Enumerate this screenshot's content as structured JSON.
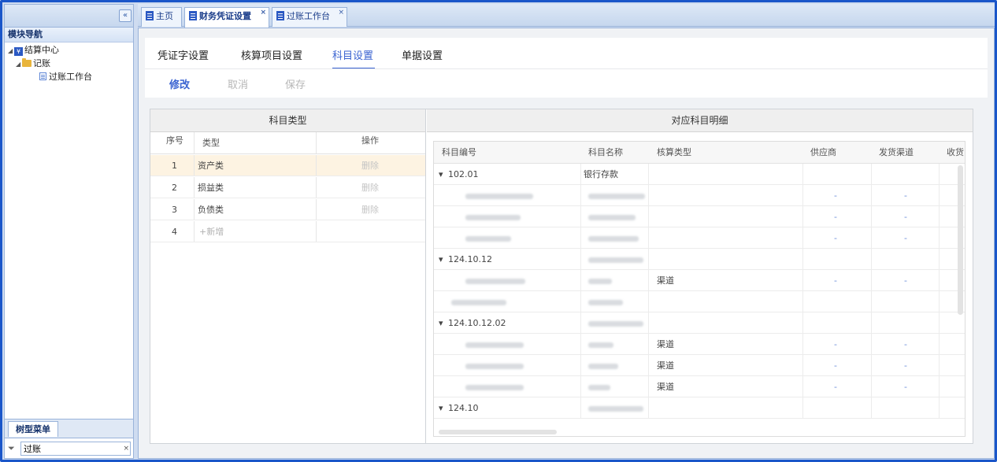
{
  "left_panel": {
    "collapse_glyph": "«",
    "nav_title": "模块导航",
    "tree": [
      {
        "label": "结算中心",
        "icon": "yen-module-icon"
      },
      {
        "label": "记账",
        "icon": "folder-icon"
      },
      {
        "label": "过账工作台",
        "icon": "document-icon"
      }
    ],
    "bottom_tab": "树型菜单",
    "filter_value": "过账"
  },
  "tabs": [
    {
      "label": "主页"
    },
    {
      "label": "财务凭证设置"
    },
    {
      "label": "过账工作台"
    }
  ],
  "close_glyph": "×",
  "subtabs": [
    {
      "label": "凭证字设置"
    },
    {
      "label": "核算项目设置"
    },
    {
      "label": "科目设置"
    },
    {
      "label": "单据设置"
    }
  ],
  "actions": {
    "edit": "修改",
    "cancel": "取消",
    "save": "保存"
  },
  "left_table": {
    "title": "科目类型",
    "headers": {
      "index": "序号",
      "type": "类型",
      "op": "操作"
    },
    "rows": [
      {
        "index": "1",
        "type": "资产类",
        "op": "删除"
      },
      {
        "index": "2",
        "type": "损益类",
        "op": "删除"
      },
      {
        "index": "3",
        "type": "负债类",
        "op": "删除"
      }
    ],
    "add_row": {
      "index": "4",
      "label": "+新增"
    }
  },
  "right_table": {
    "title": "对应科目明细",
    "headers": {
      "code": "科目编号",
      "name": "科目名称",
      "acct_type": "核算类型",
      "supplier": "供应商",
      "channel": "发货渠道",
      "receive": "收货"
    },
    "rows": [
      {
        "kind": "group",
        "code": "102.01",
        "name": "银行存款",
        "acct_type": "",
        "supplier": "",
        "channel": ""
      },
      {
        "kind": "child",
        "acct_type": "",
        "supplier": "-",
        "channel": "-"
      },
      {
        "kind": "child",
        "acct_type": "",
        "supplier": "-",
        "channel": "-"
      },
      {
        "kind": "child",
        "acct_type": "",
        "supplier": "-",
        "channel": "-"
      },
      {
        "kind": "group",
        "code": "124.10.12",
        "acct_type": "",
        "supplier": "",
        "channel": ""
      },
      {
        "kind": "child",
        "acct_type": "渠道",
        "supplier": "-",
        "channel": "-"
      },
      {
        "kind": "child",
        "acct_type": "",
        "supplier": "",
        "channel": ""
      },
      {
        "kind": "group",
        "code": "124.10.12.02",
        "acct_type": "",
        "supplier": "",
        "channel": ""
      },
      {
        "kind": "child",
        "acct_type": "渠道",
        "supplier": "-",
        "channel": "-"
      },
      {
        "kind": "child",
        "acct_type": "渠道",
        "supplier": "-",
        "channel": "-"
      },
      {
        "kind": "child",
        "acct_type": "渠道",
        "supplier": "-",
        "channel": "-"
      },
      {
        "kind": "group",
        "code": "124.10",
        "acct_type": "",
        "supplier": "",
        "channel": ""
      }
    ]
  },
  "colors": {
    "accent": "#3a63d1",
    "frame": "#1a56c9",
    "selected_row": "#fdf3e2"
  }
}
